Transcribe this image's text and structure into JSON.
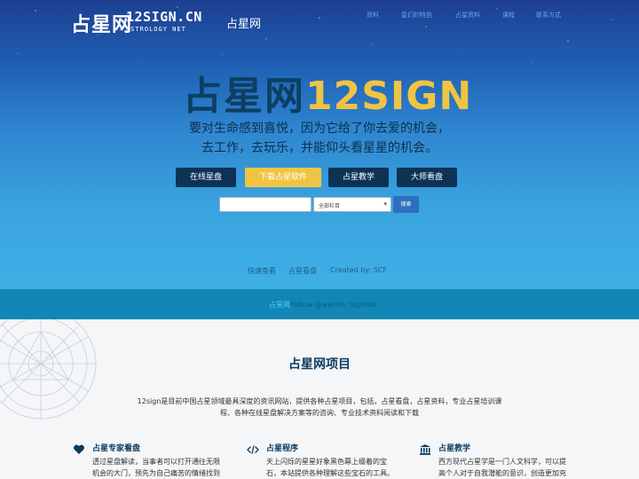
{
  "header": {
    "logo_cn": "占星网",
    "logo_en": "12SIGN.CN",
    "logo_sub": "ASTROLOGY NET",
    "site_name": "占星网",
    "nav": [
      "资料",
      "星们的特色",
      "占星资料",
      "课程",
      "联系方式"
    ]
  },
  "hero": {
    "title_cn": "占星网",
    "title_num": "12SIGN",
    "slogan_1": "要对生命感到喜悦，因为它给了你去爱的机会，",
    "slogan_2": "去工作，去玩乐，并能仰头看星星的机会。",
    "buttons": [
      "在线星盘",
      "下载占星软件",
      "占星教学",
      "大师看盘"
    ]
  },
  "search": {
    "input_value": "",
    "select_value": "全部栏目",
    "button": "搜索"
  },
  "links": {
    "l1": "快速查看",
    "l2": "占星看盘",
    "l3": "Created by: SCF"
  },
  "footer": {
    "highlight": "占星网",
    "text": "Follow @weixin: liqylook"
  },
  "projects": {
    "title": "占星网项目",
    "desc": "12sign是目前中国占星领域最具深度的资讯网站，提供各种占星项目，包括，占星看盘，占星资料，专业占星培训课程、各种在线星盘解决方案等的咨询、专业技术资料阅读和下载",
    "features": [
      {
        "icon": "heart-icon",
        "title": "占星专家看盘",
        "body": "透过星盘解读，当事者可以打开通往无限机会的大门，预先为自己痛苦的情绪找到疏散或消解的方法。"
      },
      {
        "icon": "code-icon",
        "title": "占星程序",
        "body": "天上闪烁的星星好象黑色幕上缀着的宝石，本站提供各种理解这些宝石的工具。"
      },
      {
        "icon": "bank-icon",
        "title": "占星教学",
        "body": "西方现代占星学是一门人文科学，可以提高个人对于自我潜能的意识，创造更加充实的人生。"
      }
    ]
  },
  "colors": {
    "hero_top": "#1e3f91",
    "hero_bottom": "#3fb0e6",
    "dark_button": "#0c3355",
    "yellow_accent": "#f0c443",
    "footer_bar": "#1286b4",
    "title_dark": "#0c3b5e"
  }
}
